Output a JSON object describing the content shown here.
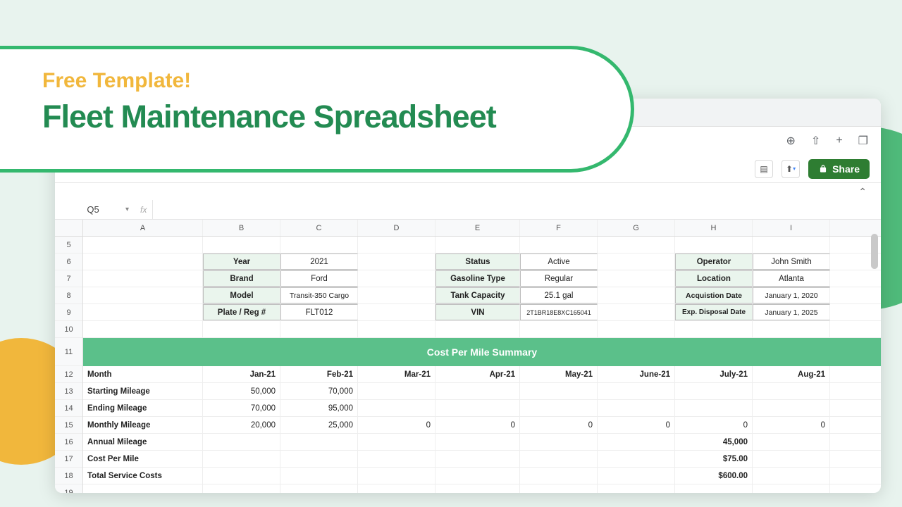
{
  "promo": {
    "subhead": "Free Template!",
    "heading": "Fleet Maintenance Spreadsheet"
  },
  "toolbar": {
    "share_label": "Share"
  },
  "name_box": "Q5",
  "columns": [
    "A",
    "B",
    "C",
    "D",
    "E",
    "F",
    "G",
    "H",
    "I"
  ],
  "row_nums": [
    "5",
    "6",
    "7",
    "8",
    "9",
    "10",
    "11",
    "12",
    "13",
    "14",
    "15",
    "16",
    "17",
    "18",
    "19"
  ],
  "info_block1": {
    "r1_label": "Year",
    "r1_val": "2021",
    "r2_label": "Brand",
    "r2_val": "Ford",
    "r3_label": "Model",
    "r3_val": "Transit-350 Cargo",
    "r4_label": "Plate / Reg #",
    "r4_val": "FLT012"
  },
  "info_block2": {
    "r1_label": "Status",
    "r1_val": "Active",
    "r2_label": "Gasoline Type",
    "r2_val": "Regular",
    "r3_label": "Tank Capacity",
    "r3_val": "25.1 gal",
    "r4_label": "VIN",
    "r4_val": "2T1BR18E8XC165041"
  },
  "info_block3": {
    "r1_label": "Operator",
    "r1_val": "John Smith",
    "r2_label": "Location",
    "r2_val": "Atlanta",
    "r3_label": "Acquistion Date",
    "r3_val": "January 1, 2020",
    "r4_label": "Exp. Disposal Date",
    "r4_val": "January 1, 2025"
  },
  "summary_title": "Cost Per Mile Summary",
  "months_label": "Month",
  "months": [
    "Jan-21",
    "Feb-21",
    "Mar-21",
    "Apr-21",
    "May-21",
    "June-21",
    "July-21",
    "Aug-21"
  ],
  "row_starting": "Starting Mileage",
  "starting": [
    "50,000",
    "70,000",
    "",
    "",
    "",
    "",
    "",
    ""
  ],
  "row_ending": "Ending Mileage",
  "ending": [
    "70,000",
    "95,000",
    "",
    "",
    "",
    "",
    "",
    ""
  ],
  "row_monthly": "Monthly Mileage",
  "monthly": [
    "20,000",
    "25,000",
    "0",
    "0",
    "0",
    "0",
    "0",
    "0"
  ],
  "row_annual": "Annual Mileage",
  "annual_val": "45,000",
  "row_cpm": "Cost Per Mile",
  "cpm_val": "$75.00",
  "row_total": "Total Service Costs",
  "total_val": "$600.00"
}
